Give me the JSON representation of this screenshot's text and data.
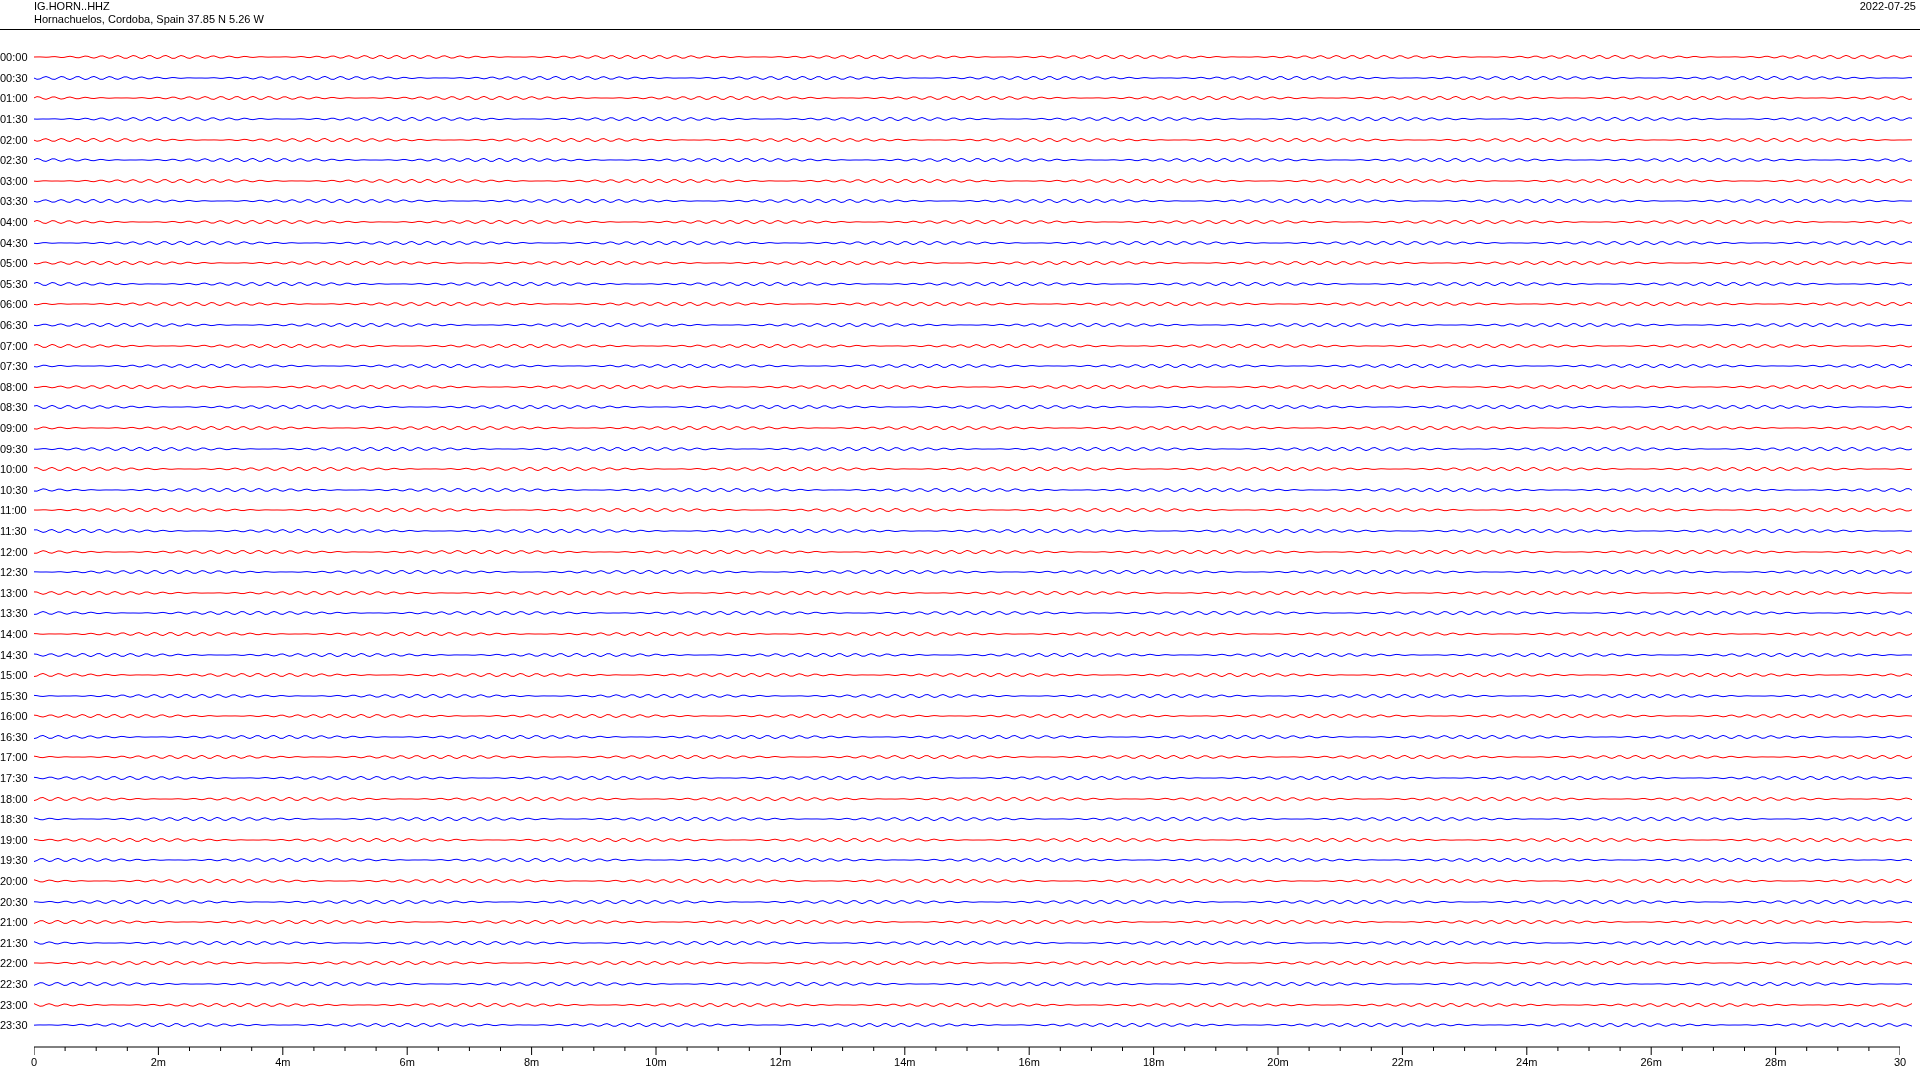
{
  "header": {
    "station": "IG.HORN..HHZ",
    "location": "Hornachuelos, Cordoba, Spain  37.85 N 5.26 W",
    "date": "2022-07-25"
  },
  "rows": [
    {
      "time": "00:00",
      "color": "#ff0000"
    },
    {
      "time": "00:30",
      "color": "#0000ff"
    },
    {
      "time": "01:00",
      "color": "#ff0000"
    },
    {
      "time": "01:30",
      "color": "#0000ff"
    },
    {
      "time": "02:00",
      "color": "#ff0000"
    },
    {
      "time": "02:30",
      "color": "#0000ff"
    },
    {
      "time": "03:00",
      "color": "#ff0000"
    },
    {
      "time": "03:30",
      "color": "#0000ff"
    },
    {
      "time": "04:00",
      "color": "#ff0000"
    },
    {
      "time": "04:30",
      "color": "#0000ff"
    },
    {
      "time": "05:00",
      "color": "#ff0000"
    },
    {
      "time": "05:30",
      "color": "#0000ff"
    },
    {
      "time": "06:00",
      "color": "#ff0000"
    },
    {
      "time": "06:30",
      "color": "#0000ff"
    },
    {
      "time": "07:00",
      "color": "#ff0000"
    },
    {
      "time": "07:30",
      "color": "#0000ff"
    },
    {
      "time": "08:00",
      "color": "#ff0000"
    },
    {
      "time": "08:30",
      "color": "#0000ff"
    },
    {
      "time": "09:00",
      "color": "#ff0000"
    },
    {
      "time": "09:30",
      "color": "#0000ff"
    },
    {
      "time": "10:00",
      "color": "#ff0000"
    },
    {
      "time": "10:30",
      "color": "#0000ff"
    },
    {
      "time": "11:00",
      "color": "#ff0000"
    },
    {
      "time": "11:30",
      "color": "#0000ff"
    },
    {
      "time": "12:00",
      "color": "#ff0000"
    },
    {
      "time": "12:30",
      "color": "#0000ff"
    },
    {
      "time": "13:00",
      "color": "#ff0000"
    },
    {
      "time": "13:30",
      "color": "#0000ff"
    },
    {
      "time": "14:00",
      "color": "#ff0000"
    },
    {
      "time": "14:30",
      "color": "#0000ff"
    },
    {
      "time": "15:00",
      "color": "#ff0000"
    },
    {
      "time": "15:30",
      "color": "#0000ff"
    },
    {
      "time": "16:00",
      "color": "#ff0000"
    },
    {
      "time": "16:30",
      "color": "#0000ff"
    },
    {
      "time": "17:00",
      "color": "#ff0000"
    },
    {
      "time": "17:30",
      "color": "#0000ff"
    },
    {
      "time": "18:00",
      "color": "#ff0000"
    },
    {
      "time": "18:30",
      "color": "#0000ff"
    },
    {
      "time": "19:00",
      "color": "#ff0000"
    },
    {
      "time": "19:30",
      "color": "#0000ff"
    },
    {
      "time": "20:00",
      "color": "#ff0000"
    },
    {
      "time": "20:30",
      "color": "#0000ff"
    },
    {
      "time": "21:00",
      "color": "#ff0000"
    },
    {
      "time": "21:30",
      "color": "#0000ff"
    },
    {
      "time": "22:00",
      "color": "#ff0000"
    },
    {
      "time": "22:30",
      "color": "#0000ff"
    },
    {
      "time": "23:00",
      "color": "#ff0000"
    },
    {
      "time": "23:30",
      "color": "#0000ff"
    }
  ],
  "axis": {
    "labels": [
      "0",
      "2m",
      "4m",
      "6m",
      "8m",
      "10m",
      "12m",
      "14m",
      "16m",
      "18m",
      "20m",
      "22m",
      "24m",
      "26m",
      "28m",
      "30"
    ]
  }
}
